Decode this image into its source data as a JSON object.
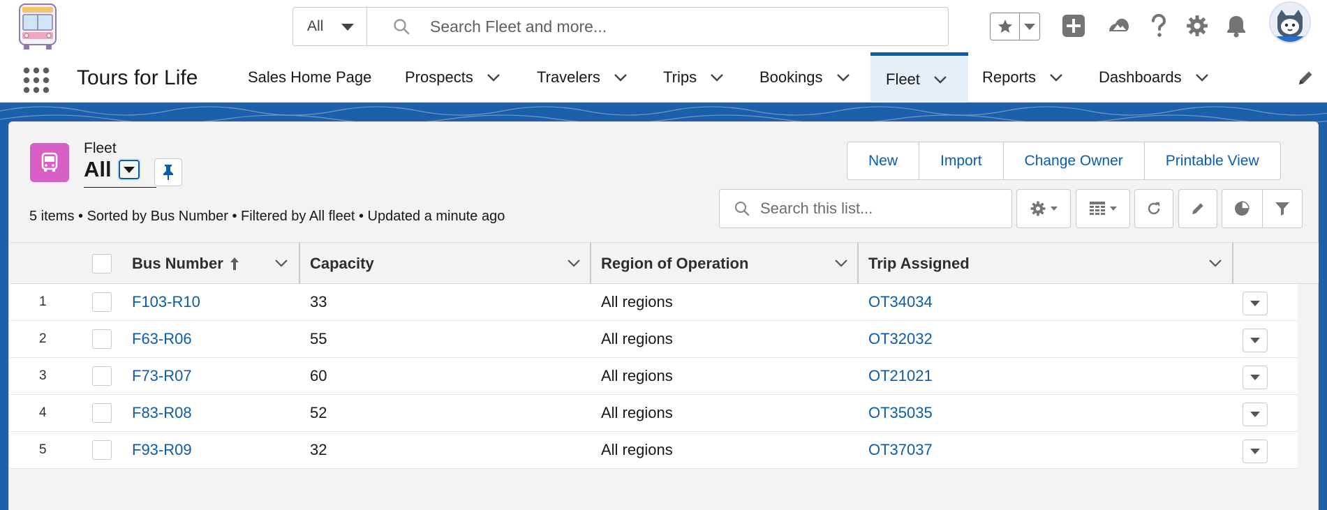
{
  "search": {
    "scope": "All",
    "placeholder": "Search Fleet and more..."
  },
  "header_icons": [
    "star-icon",
    "add-icon",
    "trailhead-icon",
    "help-icon",
    "setup-gear-icon",
    "notification-bell-icon",
    "avatar"
  ],
  "nav": {
    "app_name": "Tours for Life",
    "items": [
      {
        "label": "Sales Home Page",
        "has_menu": false
      },
      {
        "label": "Prospects",
        "has_menu": true
      },
      {
        "label": "Travelers",
        "has_menu": true
      },
      {
        "label": "Trips",
        "has_menu": true
      },
      {
        "label": "Bookings",
        "has_menu": true
      },
      {
        "label": "Fleet",
        "has_menu": true,
        "active": true
      },
      {
        "label": "Reports",
        "has_menu": true
      },
      {
        "label": "Dashboards",
        "has_menu": true
      }
    ]
  },
  "list_view": {
    "object_label": "Fleet",
    "view_name": "All",
    "summary": "5 items • Sorted by Bus Number • Filtered by All fleet • Updated a minute ago",
    "buttons": [
      "New",
      "Import",
      "Change Owner",
      "Printable View"
    ],
    "search_placeholder": "Search this list..."
  },
  "table": {
    "columns": [
      "Bus Number",
      "Capacity",
      "Region of Operation",
      "Trip Assigned"
    ],
    "sort_column": "Bus Number",
    "sort_direction": "ascending",
    "rows": [
      {
        "num": "1",
        "bus": "F103-R10",
        "capacity": "33",
        "region": "All regions",
        "trip": "OT34034"
      },
      {
        "num": "2",
        "bus": "F63-R06",
        "capacity": "55",
        "region": "All regions",
        "trip": "OT32032"
      },
      {
        "num": "3",
        "bus": "F73-R07",
        "capacity": "60",
        "region": "All regions",
        "trip": "OT21021"
      },
      {
        "num": "4",
        "bus": "F83-R08",
        "capacity": "52",
        "region": "All regions",
        "trip": "OT35035"
      },
      {
        "num": "5",
        "bus": "F93-R09",
        "capacity": "32",
        "region": "All regions",
        "trip": "OT37037"
      }
    ]
  },
  "colors": {
    "brand": "#0b5cab",
    "band": "#1c5faa",
    "object_icon": "#d85fc6",
    "link": "#0b5cab"
  }
}
